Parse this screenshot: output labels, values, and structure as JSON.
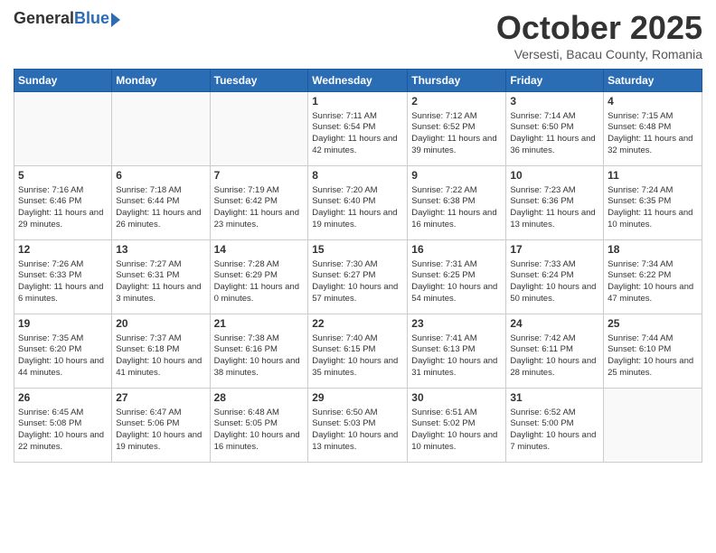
{
  "logo": {
    "general": "General",
    "blue": "Blue"
  },
  "title": "October 2025",
  "location": "Versesti, Bacau County, Romania",
  "days_of_week": [
    "Sunday",
    "Monday",
    "Tuesday",
    "Wednesday",
    "Thursday",
    "Friday",
    "Saturday"
  ],
  "weeks": [
    [
      {
        "day": "",
        "info": ""
      },
      {
        "day": "",
        "info": ""
      },
      {
        "day": "",
        "info": ""
      },
      {
        "day": "1",
        "info": "Sunrise: 7:11 AM\nSunset: 6:54 PM\nDaylight: 11 hours and 42 minutes."
      },
      {
        "day": "2",
        "info": "Sunrise: 7:12 AM\nSunset: 6:52 PM\nDaylight: 11 hours and 39 minutes."
      },
      {
        "day": "3",
        "info": "Sunrise: 7:14 AM\nSunset: 6:50 PM\nDaylight: 11 hours and 36 minutes."
      },
      {
        "day": "4",
        "info": "Sunrise: 7:15 AM\nSunset: 6:48 PM\nDaylight: 11 hours and 32 minutes."
      }
    ],
    [
      {
        "day": "5",
        "info": "Sunrise: 7:16 AM\nSunset: 6:46 PM\nDaylight: 11 hours and 29 minutes."
      },
      {
        "day": "6",
        "info": "Sunrise: 7:18 AM\nSunset: 6:44 PM\nDaylight: 11 hours and 26 minutes."
      },
      {
        "day": "7",
        "info": "Sunrise: 7:19 AM\nSunset: 6:42 PM\nDaylight: 11 hours and 23 minutes."
      },
      {
        "day": "8",
        "info": "Sunrise: 7:20 AM\nSunset: 6:40 PM\nDaylight: 11 hours and 19 minutes."
      },
      {
        "day": "9",
        "info": "Sunrise: 7:22 AM\nSunset: 6:38 PM\nDaylight: 11 hours and 16 minutes."
      },
      {
        "day": "10",
        "info": "Sunrise: 7:23 AM\nSunset: 6:36 PM\nDaylight: 11 hours and 13 minutes."
      },
      {
        "day": "11",
        "info": "Sunrise: 7:24 AM\nSunset: 6:35 PM\nDaylight: 11 hours and 10 minutes."
      }
    ],
    [
      {
        "day": "12",
        "info": "Sunrise: 7:26 AM\nSunset: 6:33 PM\nDaylight: 11 hours and 6 minutes."
      },
      {
        "day": "13",
        "info": "Sunrise: 7:27 AM\nSunset: 6:31 PM\nDaylight: 11 hours and 3 minutes."
      },
      {
        "day": "14",
        "info": "Sunrise: 7:28 AM\nSunset: 6:29 PM\nDaylight: 11 hours and 0 minutes."
      },
      {
        "day": "15",
        "info": "Sunrise: 7:30 AM\nSunset: 6:27 PM\nDaylight: 10 hours and 57 minutes."
      },
      {
        "day": "16",
        "info": "Sunrise: 7:31 AM\nSunset: 6:25 PM\nDaylight: 10 hours and 54 minutes."
      },
      {
        "day": "17",
        "info": "Sunrise: 7:33 AM\nSunset: 6:24 PM\nDaylight: 10 hours and 50 minutes."
      },
      {
        "day": "18",
        "info": "Sunrise: 7:34 AM\nSunset: 6:22 PM\nDaylight: 10 hours and 47 minutes."
      }
    ],
    [
      {
        "day": "19",
        "info": "Sunrise: 7:35 AM\nSunset: 6:20 PM\nDaylight: 10 hours and 44 minutes."
      },
      {
        "day": "20",
        "info": "Sunrise: 7:37 AM\nSunset: 6:18 PM\nDaylight: 10 hours and 41 minutes."
      },
      {
        "day": "21",
        "info": "Sunrise: 7:38 AM\nSunset: 6:16 PM\nDaylight: 10 hours and 38 minutes."
      },
      {
        "day": "22",
        "info": "Sunrise: 7:40 AM\nSunset: 6:15 PM\nDaylight: 10 hours and 35 minutes."
      },
      {
        "day": "23",
        "info": "Sunrise: 7:41 AM\nSunset: 6:13 PM\nDaylight: 10 hours and 31 minutes."
      },
      {
        "day": "24",
        "info": "Sunrise: 7:42 AM\nSunset: 6:11 PM\nDaylight: 10 hours and 28 minutes."
      },
      {
        "day": "25",
        "info": "Sunrise: 7:44 AM\nSunset: 6:10 PM\nDaylight: 10 hours and 25 minutes."
      }
    ],
    [
      {
        "day": "26",
        "info": "Sunrise: 6:45 AM\nSunset: 5:08 PM\nDaylight: 10 hours and 22 minutes."
      },
      {
        "day": "27",
        "info": "Sunrise: 6:47 AM\nSunset: 5:06 PM\nDaylight: 10 hours and 19 minutes."
      },
      {
        "day": "28",
        "info": "Sunrise: 6:48 AM\nSunset: 5:05 PM\nDaylight: 10 hours and 16 minutes."
      },
      {
        "day": "29",
        "info": "Sunrise: 6:50 AM\nSunset: 5:03 PM\nDaylight: 10 hours and 13 minutes."
      },
      {
        "day": "30",
        "info": "Sunrise: 6:51 AM\nSunset: 5:02 PM\nDaylight: 10 hours and 10 minutes."
      },
      {
        "day": "31",
        "info": "Sunrise: 6:52 AM\nSunset: 5:00 PM\nDaylight: 10 hours and 7 minutes."
      },
      {
        "day": "",
        "info": ""
      }
    ]
  ]
}
